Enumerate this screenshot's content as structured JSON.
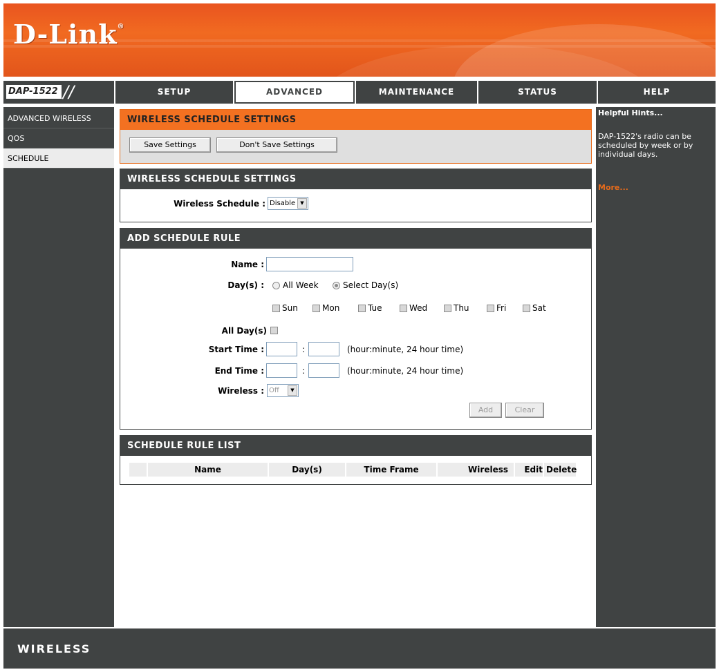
{
  "brand": {
    "logo": "D-Link",
    "model": "DAP-1522",
    "footer_text": "WIRELESS"
  },
  "nav": {
    "tabs": [
      {
        "label": "SETUP",
        "active": false
      },
      {
        "label": "ADVANCED",
        "active": true
      },
      {
        "label": "MAINTENANCE",
        "active": false
      },
      {
        "label": "STATUS",
        "active": false
      },
      {
        "label": "HELP",
        "active": false
      }
    ]
  },
  "sidebar": {
    "items": [
      {
        "label": "ADVANCED WIRELESS",
        "active": false
      },
      {
        "label": "QOS",
        "active": false
      },
      {
        "label": "SCHEDULE",
        "active": true
      }
    ]
  },
  "hints": {
    "title": "Helpful Hints...",
    "body": "DAP-1522's radio can be scheduled by week or by individual days.",
    "more": "More..."
  },
  "top_section": {
    "title": "WIRELESS SCHEDULE SETTINGS",
    "save_label": "Save Settings",
    "dont_save_label": "Don't Save Settings"
  },
  "schedule_settings": {
    "title": "WIRELESS SCHEDULE SETTINGS",
    "wireless_schedule_label": "Wireless Schedule :",
    "wireless_schedule_value": "Disable"
  },
  "add_rule": {
    "title": "ADD SCHEDULE RULE",
    "name_label": "Name :",
    "name_value": "",
    "days_label": "Day(s) :",
    "all_week_label": "All Week",
    "select_days_label": "Select Day(s)",
    "selected_option": "Select Day(s)",
    "days": [
      "Sun",
      "Mon",
      "Tue",
      "Wed",
      "Thu",
      "Fri",
      "Sat"
    ],
    "all_day_label": "All Day(s)",
    "start_time_label": "Start Time :",
    "end_time_label": "End Time :",
    "colon": ":",
    "time_hint": "(hour:minute, 24 hour time)",
    "start_hour": "",
    "start_minute": "",
    "end_hour": "",
    "end_minute": "",
    "wireless_label": "Wireless :",
    "wireless_value": "Off",
    "add_label": "Add",
    "clear_label": "Clear"
  },
  "rule_list": {
    "title": "SCHEDULE RULE LIST",
    "columns": [
      "Name",
      "Day(s)",
      "Time Frame",
      "Wireless",
      "Edit",
      "Delete"
    ]
  },
  "colors": {
    "accent": "#f37121",
    "dark": "#404343"
  },
  "icons": {
    "dropdown": "chevron-down-icon"
  }
}
